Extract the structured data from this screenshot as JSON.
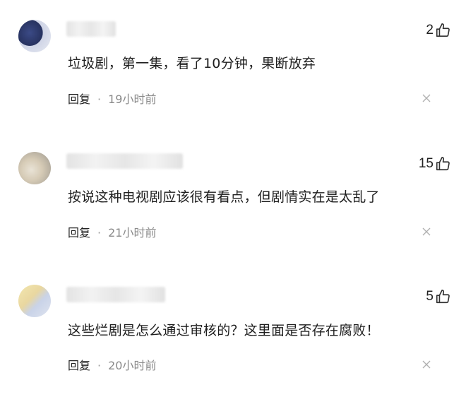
{
  "comments": [
    {
      "likes": "2",
      "text": "垃圾剧，第一集，看了10分钟，果断放弃",
      "reply_label": "回复",
      "separator": "·",
      "time": "19小时前"
    },
    {
      "likes": "15",
      "text": "按说这种电视剧应该很有看点，但剧情实在是太乱了",
      "reply_label": "回复",
      "separator": "·",
      "time": "21小时前"
    },
    {
      "likes": "5",
      "text": "这些烂剧是怎么通过审核的？这里面是否存在腐败！",
      "reply_label": "回复",
      "separator": "·",
      "time": "20小时前"
    }
  ],
  "icons": {
    "like": "thumbs-up-icon",
    "close": "close-icon"
  },
  "colors": {
    "text": "#1e1e1e",
    "time": "#8a8a8a"
  }
}
